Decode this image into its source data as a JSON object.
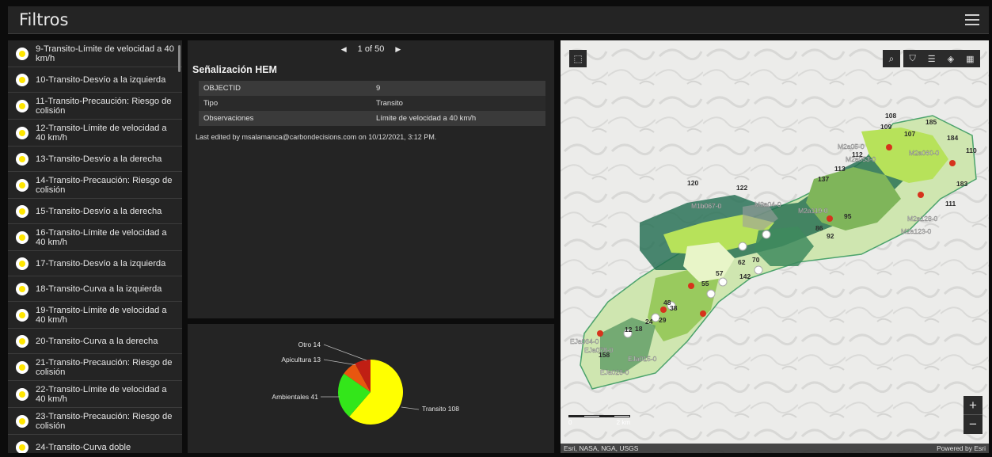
{
  "header": {
    "title": "Filtros"
  },
  "list": {
    "items": [
      {
        "label": "9-Transito-Límite de velocidad a 40 km/h"
      },
      {
        "label": "10-Transito-Desvío a la izquierda"
      },
      {
        "label": "11-Transito-Precaución: Riesgo de colisión"
      },
      {
        "label": "12-Transito-Límite de velocidad a 40 km/h"
      },
      {
        "label": "13-Transito-Desvío a la derecha"
      },
      {
        "label": "14-Transito-Precaución: Riesgo de colisión"
      },
      {
        "label": "15-Transito-Desvío a la derecha"
      },
      {
        "label": "16-Transito-Límite de velocidad a 40 km/h"
      },
      {
        "label": "17-Transito-Desvío a la izquierda"
      },
      {
        "label": "18-Transito-Curva a la izquierda"
      },
      {
        "label": "19-Transito-Límite de velocidad a 40 km/h"
      },
      {
        "label": "20-Transito-Curva a la derecha"
      },
      {
        "label": "21-Transito-Precaución: Riesgo de colisión"
      },
      {
        "label": "22-Transito-Límite de velocidad a 40 km/h"
      },
      {
        "label": "23-Transito-Precaución: Riesgo de colisión"
      },
      {
        "label": "24-Transito-Curva doble"
      }
    ]
  },
  "detail": {
    "pager_text": "1 of 50",
    "title": "Señalización HEM",
    "rows": [
      {
        "key": "OBJECTID",
        "value": "9"
      },
      {
        "key": "Tipo",
        "value": "Transito"
      },
      {
        "key": "Observaciones",
        "value": "Límite de velocidad a 40 km/h"
      }
    ],
    "edited_text": "Last edited by msalamanca@carbondecisions.com on 10/12/2021, 3:12 PM."
  },
  "chart_data": {
    "type": "pie",
    "slices": [
      {
        "label": "Transito",
        "value": 108,
        "color": "#ffff00"
      },
      {
        "label": "Ambientales",
        "value": 41,
        "color": "#33e61a"
      },
      {
        "label": "Apicultura",
        "value": 13,
        "color": "#e8560f"
      },
      {
        "label": "Otro",
        "value": 14,
        "color": "#c01f14"
      }
    ],
    "slice_labels": [
      "Transito 108",
      "Ambientales 41",
      "Apicultura 13",
      "Otro 14"
    ]
  },
  "map": {
    "attribution_left": "Esri, NASA, NGA, USGS",
    "attribution_right": "Powered by Esri",
    "scale_start": "0",
    "scale_end": "2 km",
    "labels": [
      "108",
      "109",
      "185",
      "107",
      "184",
      "110",
      "120",
      "122",
      "183",
      "111",
      "112",
      "113",
      "137",
      "142",
      "62",
      "70",
      "55",
      "57",
      "38",
      "29",
      "48",
      "24",
      "18",
      "12",
      "158",
      "86",
      "92",
      "95"
    ],
    "feature_labels": [
      "M2a05-0",
      "M2a060-0",
      "M1b067-0",
      "M2a04-0",
      "M2a119-0",
      "M2a128-0",
      "M2a123-0",
      "EJa064-0",
      "EJa078-0",
      "EJa015-0",
      "EJa028-0",
      "M2a053-0"
    ],
    "zoom_in": "+",
    "zoom_out": "−",
    "colors": {
      "polygon_dark": "#1f6b4f",
      "polygon_light": "#b7e25a",
      "outline": "#4ca36c",
      "marker_red": "#d6331c"
    }
  }
}
